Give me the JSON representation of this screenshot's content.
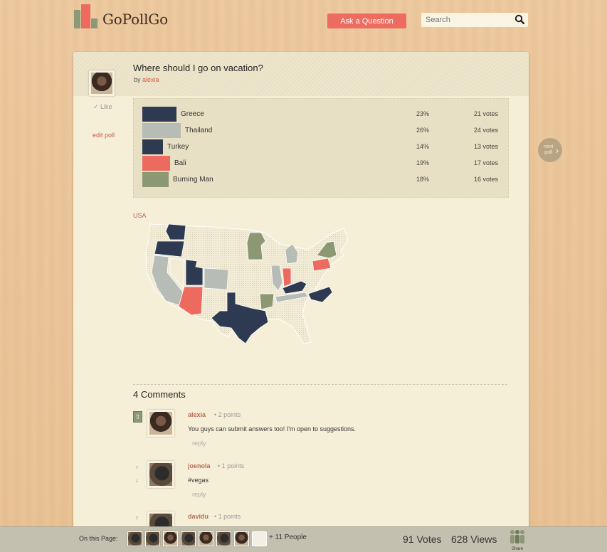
{
  "header": {
    "logo_text": "GoPollGo",
    "ask_button": "Ask a Question",
    "search_placeholder": "Search"
  },
  "poll": {
    "title": "Where should I go on vacation?",
    "by_label": "by",
    "author": "alexia",
    "like_label": "✓ Like",
    "edit_label": "edit poll",
    "options": [
      {
        "label": "Greece",
        "percent": "23%",
        "votes": "21 votes",
        "share": 0.23,
        "color": "#2d3a52"
      },
      {
        "label": "Thailand",
        "percent": "26%",
        "votes": "24 votes",
        "share": 0.26,
        "color": "#b8bcb6"
      },
      {
        "label": "Turkey",
        "percent": "14%",
        "votes": "13 votes",
        "share": 0.14,
        "color": "#2d3a52"
      },
      {
        "label": "Bali",
        "percent": "19%",
        "votes": "17 votes",
        "share": 0.19,
        "color": "#ec6a5e"
      },
      {
        "label": "Burning Man",
        "percent": "18%",
        "votes": "16 votes",
        "share": 0.18,
        "color": "#8c9874"
      }
    ]
  },
  "map": {
    "label": "USA",
    "colors": {
      "navy": "#2d3a52",
      "gray": "#b8bcb6",
      "coral": "#ec6a5e",
      "sage": "#8c9874",
      "default": "#f2ecd6"
    }
  },
  "comments": {
    "title": "4 Comments",
    "items": [
      {
        "author": "alexia",
        "points": "2 points",
        "text": "You guys can submit answers too! I'm open to suggestions.",
        "reply": "reply"
      },
      {
        "author": "joenola",
        "points": "1 points",
        "text": "#vegas",
        "reply": "reply"
      },
      {
        "author": "davidu",
        "points": "1 points",
        "text": "",
        "reply": ""
      }
    ]
  },
  "next_poll_label": "next poll",
  "footer": {
    "on_page_label": "On this Page:",
    "more_people": "+ 11 People",
    "votes": "91 Votes",
    "views": "628 Views",
    "share_label": "Share"
  }
}
